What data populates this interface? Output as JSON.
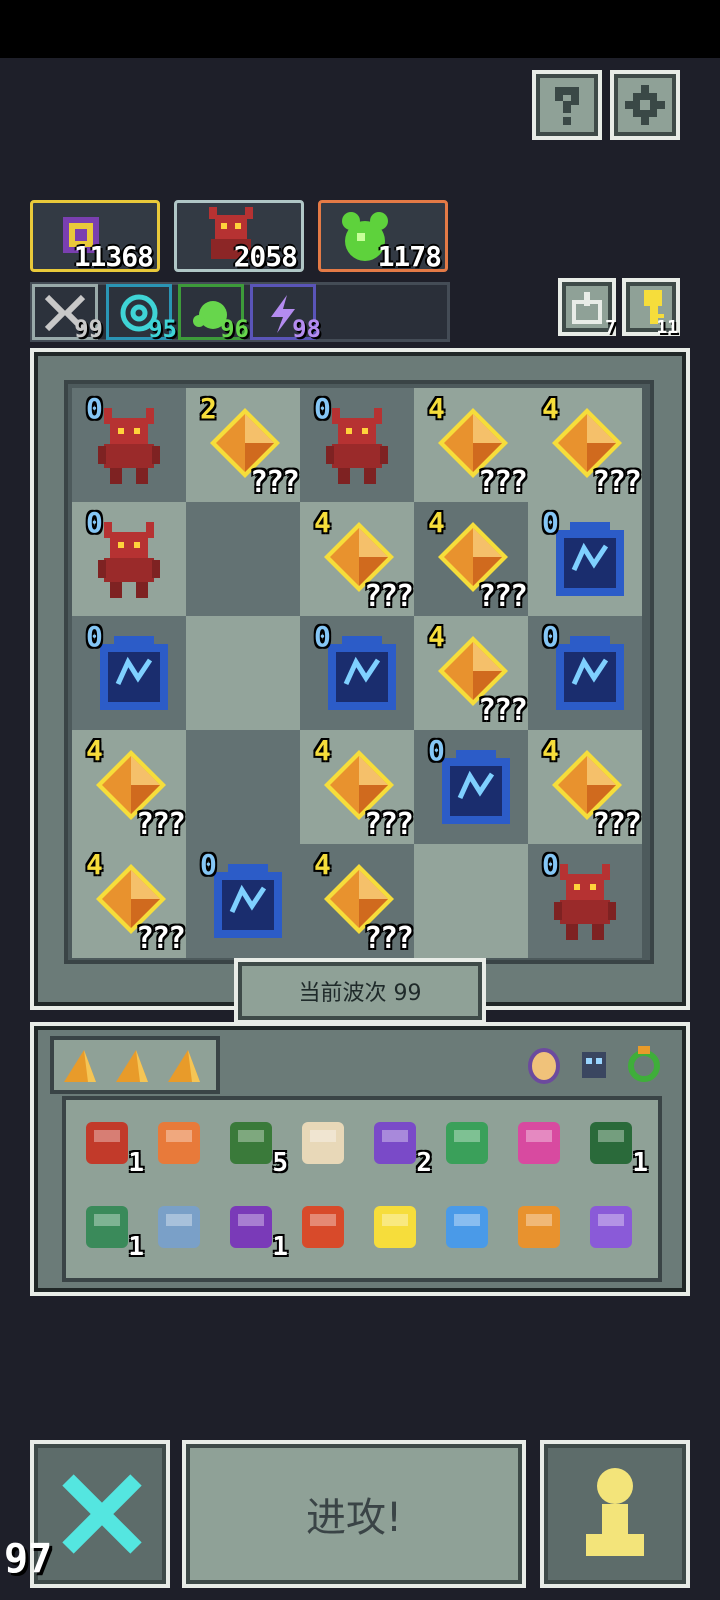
{
  "top_buttons": {
    "help_icon": "question-mark",
    "settings_icon": "gear"
  },
  "resources": [
    {
      "name": "cursed-sigil",
      "value": "11368",
      "border": "#e9c93a"
    },
    {
      "name": "demon",
      "value": "2058",
      "border": "#b0c6c6"
    },
    {
      "name": "slime",
      "value": "1178",
      "border": "#e47a46"
    }
  ],
  "stats": [
    {
      "name": "sword",
      "value": "99",
      "color": "#c8c8c8"
    },
    {
      "name": "spiral",
      "value": "95",
      "color": "#3fd4d6"
    },
    {
      "name": "blob",
      "value": "96",
      "color": "#67d64c"
    },
    {
      "name": "bolt",
      "value": "98",
      "color": "#b48cf0"
    }
  ],
  "side_counters": [
    {
      "name": "box",
      "value": "7"
    },
    {
      "name": "key",
      "value": "11"
    }
  ],
  "board": {
    "rows": [
      [
        {
          "type": "demon",
          "count": "0"
        },
        {
          "type": "crystal",
          "count": "2",
          "label": "???"
        },
        {
          "type": "demon",
          "count": "0"
        },
        {
          "type": "crystal",
          "count": "4",
          "label": "???"
        },
        {
          "type": "crystal",
          "count": "4",
          "label": "???"
        }
      ],
      [
        {
          "type": "demon",
          "count": "0"
        },
        {
          "type": "empty"
        },
        {
          "type": "crystal",
          "count": "4",
          "label": "???"
        },
        {
          "type": "crystal",
          "count": "4",
          "label": "???"
        },
        {
          "type": "altar",
          "count": "0"
        }
      ],
      [
        {
          "type": "altar",
          "count": "0"
        },
        {
          "type": "empty"
        },
        {
          "type": "altar",
          "count": "0"
        },
        {
          "type": "crystal",
          "count": "4",
          "label": "???"
        },
        {
          "type": "altar",
          "count": "0"
        }
      ],
      [
        {
          "type": "crystal",
          "count": "4",
          "label": "???"
        },
        {
          "type": "empty"
        },
        {
          "type": "crystal",
          "count": "4",
          "label": "???"
        },
        {
          "type": "altar",
          "count": "0"
        },
        {
          "type": "crystal",
          "count": "4",
          "label": "???"
        }
      ],
      [
        {
          "type": "crystal",
          "count": "4",
          "label": "???"
        },
        {
          "type": "altar",
          "count": "0"
        },
        {
          "type": "crystal",
          "count": "4",
          "label": "???"
        },
        {
          "type": "empty"
        },
        {
          "type": "demon",
          "count": "0"
        }
      ]
    ]
  },
  "wave": {
    "label": "当前波次 99"
  },
  "inventory": {
    "top_left": [
      "wedge",
      "wedge",
      "wedge"
    ],
    "top_right": [
      "egg",
      "bomb-robot",
      "ring"
    ],
    "items": [
      {
        "name": "drum",
        "count": "1"
      },
      {
        "name": "shield-face",
        "count": ""
      },
      {
        "name": "zombie",
        "count": "5"
      },
      {
        "name": "claw",
        "count": ""
      },
      {
        "name": "hourglass",
        "count": "2"
      },
      {
        "name": "green-arrow",
        "count": ""
      },
      {
        "name": "pink-arrow",
        "count": ""
      },
      {
        "name": "goblin-mask",
        "count": "1"
      },
      {
        "name": "goblin-rider",
        "count": "1"
      },
      {
        "name": "spike-crown",
        "count": ""
      },
      {
        "name": "purple-demon",
        "count": "1"
      },
      {
        "name": "fire-tile",
        "count": ""
      },
      {
        "name": "chalice",
        "count": ""
      },
      {
        "name": "blue-dragon",
        "count": ""
      },
      {
        "name": "flame-book",
        "count": ""
      },
      {
        "name": "purple-hammer",
        "count": ""
      }
    ]
  },
  "actions": {
    "attack": "进攻!"
  },
  "fps": "97"
}
